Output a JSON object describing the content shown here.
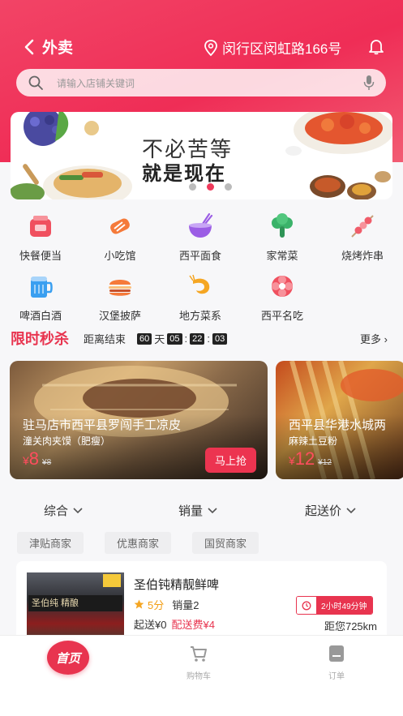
{
  "header": {
    "title": "外卖",
    "location": "闵行区闵虹路166号"
  },
  "search": {
    "placeholder": "请输入店铺关键词"
  },
  "banner": {
    "line1": "不必苦等",
    "line2": "就是现在"
  },
  "categories": [
    {
      "label": "快餐便当",
      "icon": "bento-icon",
      "color": "#f0505f"
    },
    {
      "label": "小吃馆",
      "icon": "snack-icon",
      "color": "#f57a3a"
    },
    {
      "label": "西平面食",
      "icon": "noodle-bowl-icon",
      "color": "#9b5de5"
    },
    {
      "label": "家常菜",
      "icon": "broccoli-icon",
      "color": "#3bb36a"
    },
    {
      "label": "烧烤炸串",
      "icon": "skewer-icon",
      "color": "#f05c6a"
    },
    {
      "label": "啤酒白酒",
      "icon": "beer-icon",
      "color": "#3a9ff0"
    },
    {
      "label": "汉堡披萨",
      "icon": "burger-icon",
      "color": "#f57a3a"
    },
    {
      "label": "地方菜系",
      "icon": "shrimp-icon",
      "color": "#f5a623"
    },
    {
      "label": "西平名吃",
      "icon": "flower-icon",
      "color": "#f0505f"
    }
  ],
  "flash_sale": {
    "title": "限时秒杀",
    "countdown_label": "距离结束",
    "days": "60",
    "days_unit": "天",
    "hours": "05",
    "minutes": "22",
    "seconds": "03",
    "more": "更多"
  },
  "deals": [
    {
      "name": "驻马店市西平县罗闯手工凉皮",
      "sub": "潼关肉夹馍（肥瘦）",
      "currency": "¥",
      "price": "8",
      "old_price": "¥8",
      "button": "马上抢"
    },
    {
      "name": "西平县华港水城两",
      "sub": "麻辣土豆粉",
      "currency": "¥",
      "price": "12",
      "old_price": "¥12"
    }
  ],
  "sort": {
    "comprehensive": "综合",
    "sales": "销量",
    "min_delivery": "起送价"
  },
  "filters": [
    "津贴商家",
    "优惠商家",
    "国贸商家"
  ],
  "store": {
    "name": "圣伯钝精靓鲜啤",
    "sign": "圣伯纯 精酿",
    "rating": "5分",
    "sales": "销量2",
    "min_order": "起送¥0",
    "delivery_fee": "配送费¥4",
    "time": "2小时49分钟",
    "distance": "距您725km"
  },
  "tabbar": {
    "home": "首页",
    "cart": "购物车",
    "orders": "订单"
  }
}
